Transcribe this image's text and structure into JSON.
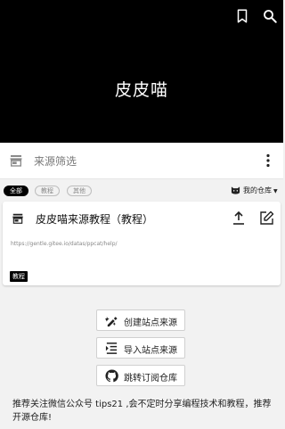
{
  "header": {
    "title": "皮皮喵"
  },
  "filter": {
    "placeholder": "来源筛选"
  },
  "chips": [
    {
      "label": "全部",
      "active": true
    },
    {
      "label": "教程",
      "active": false
    },
    {
      "label": "其他",
      "active": false
    }
  ],
  "repo": {
    "label": "我的仓库"
  },
  "source_card": {
    "title": "皮皮喵来源教程（教程）",
    "url": "https://gentle.gitee.io/datas/ppcat/help/",
    "tag": "教程"
  },
  "actions": [
    {
      "label": "创建站点来源",
      "icon": "create-icon"
    },
    {
      "label": "导入站点来源",
      "icon": "import-icon"
    },
    {
      "label": "跳转订阅仓库",
      "icon": "github-icon"
    }
  ],
  "footer": {
    "text": "推荐关注微信公众号 tips21 ,会不定时分享编程技术和教程，推荐开源仓库!"
  }
}
